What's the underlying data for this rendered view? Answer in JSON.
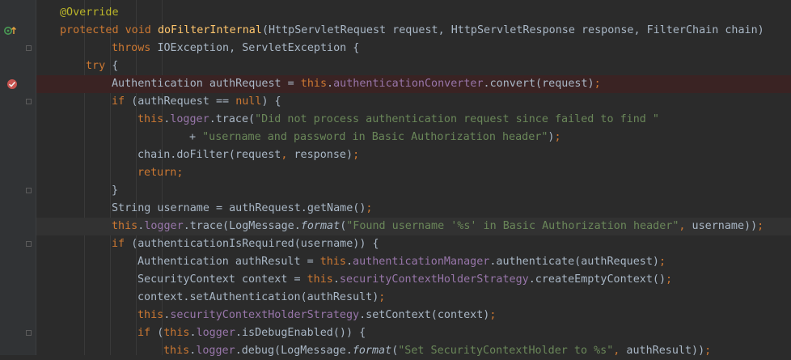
{
  "editor": {
    "lines": [
      {
        "indent": 1,
        "tokens": [
          {
            "t": "@Override",
            "c": "ann"
          }
        ]
      },
      {
        "indent": 1,
        "tokens": [
          {
            "t": "protected void ",
            "c": "kw"
          },
          {
            "t": "doFilterInternal",
            "c": "fn"
          },
          {
            "t": "(HttpServletRequest request, HttpServletResponse response, FilterChain chain)",
            "c": "txt"
          }
        ]
      },
      {
        "indent": 3,
        "tokens": [
          {
            "t": "throws ",
            "c": "kw"
          },
          {
            "t": "IOException, ServletException {",
            "c": "txt"
          }
        ]
      },
      {
        "indent": 2,
        "tokens": [
          {
            "t": "try ",
            "c": "kw"
          },
          {
            "t": "{",
            "c": "txt"
          }
        ]
      },
      {
        "indent": 3,
        "tokens": [
          {
            "t": "Authentication authRequest = ",
            "c": "txt"
          },
          {
            "t": "this",
            "c": "kw"
          },
          {
            "t": ".",
            "c": "txt"
          },
          {
            "t": "authenticationConverter",
            "c": "fld"
          },
          {
            "t": ".convert(request)",
            "c": "txt"
          },
          {
            "t": ";",
            "c": "kw"
          }
        ]
      },
      {
        "indent": 3,
        "tokens": [
          {
            "t": "if ",
            "c": "kw"
          },
          {
            "t": "(authRequest == ",
            "c": "txt"
          },
          {
            "t": "null",
            "c": "kw"
          },
          {
            "t": ") {",
            "c": "txt"
          }
        ]
      },
      {
        "indent": 4,
        "tokens": [
          {
            "t": "this",
            "c": "kw"
          },
          {
            "t": ".",
            "c": "txt"
          },
          {
            "t": "logger",
            "c": "fld"
          },
          {
            "t": ".trace(",
            "c": "txt"
          },
          {
            "t": "\"Did not process authentication request since failed to find \"",
            "c": "str"
          }
        ]
      },
      {
        "indent": 6,
        "tokens": [
          {
            "t": "+ ",
            "c": "txt"
          },
          {
            "t": "\"username and password in Basic Authorization header\"",
            "c": "str"
          },
          {
            "t": ")",
            "c": "txt"
          },
          {
            "t": ";",
            "c": "kw"
          }
        ]
      },
      {
        "indent": 4,
        "tokens": [
          {
            "t": "chain.doFilter(request",
            "c": "txt"
          },
          {
            "t": ", ",
            "c": "kw"
          },
          {
            "t": "response)",
            "c": "txt"
          },
          {
            "t": ";",
            "c": "kw"
          }
        ]
      },
      {
        "indent": 4,
        "tokens": [
          {
            "t": "return;",
            "c": "kw"
          }
        ]
      },
      {
        "indent": 3,
        "tokens": [
          {
            "t": "}",
            "c": "txt"
          }
        ]
      },
      {
        "indent": 3,
        "tokens": [
          {
            "t": "String username = authRequest.getName()",
            "c": "txt"
          },
          {
            "t": ";",
            "c": "kw"
          }
        ]
      },
      {
        "indent": 3,
        "tokens": [
          {
            "t": "this",
            "c": "kw"
          },
          {
            "t": ".",
            "c": "txt"
          },
          {
            "t": "logger",
            "c": "fld"
          },
          {
            "t": ".trace(LogMessage.",
            "c": "txt"
          },
          {
            "t": "format",
            "c": "it"
          },
          {
            "t": "(",
            "c": "txt"
          },
          {
            "t": "\"Found username '%s' in Basic Authorization header\"",
            "c": "str"
          },
          {
            "t": ", ",
            "c": "kw"
          },
          {
            "t": "username))",
            "c": "txt"
          },
          {
            "t": ";",
            "c": "kw"
          }
        ]
      },
      {
        "indent": 3,
        "tokens": [
          {
            "t": "if ",
            "c": "kw"
          },
          {
            "t": "(authenticationIsRequired(username)) {",
            "c": "txt"
          }
        ]
      },
      {
        "indent": 4,
        "tokens": [
          {
            "t": "Authentication authResult = ",
            "c": "txt"
          },
          {
            "t": "this",
            "c": "kw"
          },
          {
            "t": ".",
            "c": "txt"
          },
          {
            "t": "authenticationManager",
            "c": "fld"
          },
          {
            "t": ".authenticate(authRequest)",
            "c": "txt"
          },
          {
            "t": ";",
            "c": "kw"
          }
        ]
      },
      {
        "indent": 4,
        "tokens": [
          {
            "t": "SecurityContext context = ",
            "c": "txt"
          },
          {
            "t": "this",
            "c": "kw"
          },
          {
            "t": ".",
            "c": "txt"
          },
          {
            "t": "securityContextHolderStrategy",
            "c": "fld"
          },
          {
            "t": ".createEmptyContext()",
            "c": "txt"
          },
          {
            "t": ";",
            "c": "kw"
          }
        ]
      },
      {
        "indent": 4,
        "tokens": [
          {
            "t": "context.setAuthentication(authResult)",
            "c": "txt"
          },
          {
            "t": ";",
            "c": "kw"
          }
        ]
      },
      {
        "indent": 4,
        "tokens": [
          {
            "t": "this",
            "c": "kw"
          },
          {
            "t": ".",
            "c": "txt"
          },
          {
            "t": "securityContextHolderStrategy",
            "c": "fld"
          },
          {
            "t": ".setContext(context)",
            "c": "txt"
          },
          {
            "t": ";",
            "c": "kw"
          }
        ]
      },
      {
        "indent": 4,
        "tokens": [
          {
            "t": "if ",
            "c": "kw"
          },
          {
            "t": "(",
            "c": "txt"
          },
          {
            "t": "this",
            "c": "kw"
          },
          {
            "t": ".",
            "c": "txt"
          },
          {
            "t": "logger",
            "c": "fld"
          },
          {
            "t": ".isDebugEnabled()) {",
            "c": "txt"
          }
        ]
      },
      {
        "indent": 5,
        "tokens": [
          {
            "t": "this",
            "c": "kw"
          },
          {
            "t": ".",
            "c": "txt"
          },
          {
            "t": "logger",
            "c": "fld"
          },
          {
            "t": ".debug(LogMessage.",
            "c": "txt"
          },
          {
            "t": "format",
            "c": "it"
          },
          {
            "t": "(",
            "c": "txt"
          },
          {
            "t": "\"Set SecurityContextHolder to %s\"",
            "c": "str"
          },
          {
            "t": ", ",
            "c": "kw"
          },
          {
            "t": "authResult))",
            "c": "txt"
          },
          {
            "t": ";",
            "c": "kw"
          }
        ]
      }
    ],
    "breakpoint_line": 4,
    "current_line": 12,
    "gutter_icons": [
      {
        "line": 1,
        "icon": "override-method-icon"
      },
      {
        "line": 4,
        "icon": "breakpoint-icon"
      }
    ],
    "fold_lines": [
      2,
      5,
      10,
      13,
      18
    ]
  },
  "colors": {
    "background": "#2b2b2b",
    "gutter": "#313335",
    "keyword": "#cc7832",
    "function": "#ffc66d",
    "annotation": "#bbb529",
    "string": "#6a8759",
    "field": "#9876aa",
    "text": "#a9b7c6",
    "breakpoint": "#c75450"
  }
}
